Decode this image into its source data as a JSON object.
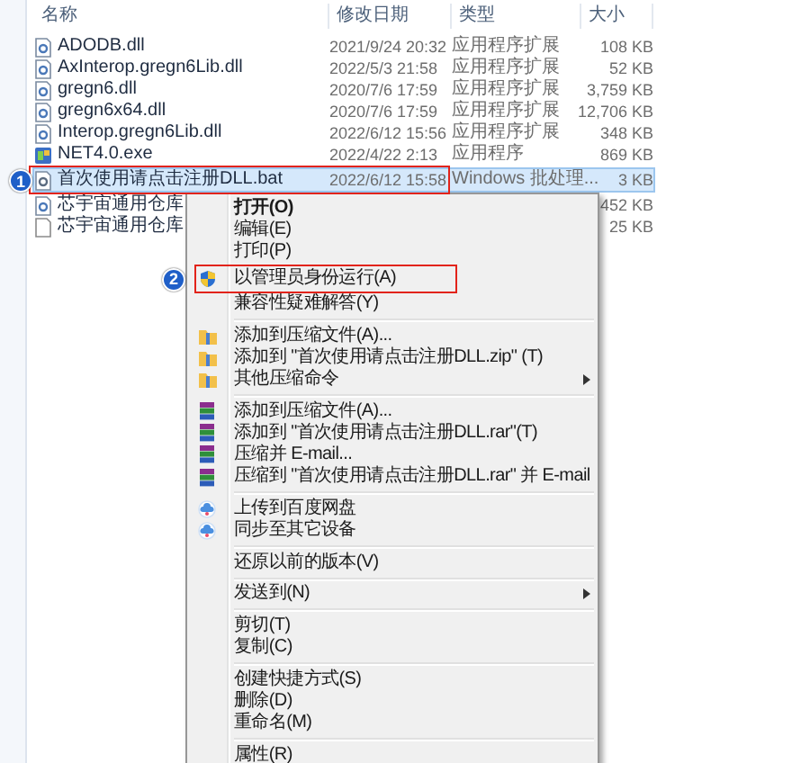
{
  "columns": [
    {
      "label": "名称"
    },
    {
      "label": "修改日期"
    },
    {
      "label": "类型"
    },
    {
      "label": "大小"
    }
  ],
  "files": [
    {
      "kind": "dll",
      "name": "ADODB.dll",
      "date": "2021/9/24 20:32",
      "type": "应用程序扩展",
      "size": "108 KB",
      "selected": false
    },
    {
      "kind": "dll",
      "name": "AxInterop.gregn6Lib.dll",
      "date": "2022/5/3 21:58",
      "type": "应用程序扩展",
      "size": "52 KB",
      "selected": false
    },
    {
      "kind": "dll",
      "name": "gregn6.dll",
      "date": "2020/7/6 17:59",
      "type": "应用程序扩展",
      "size": "3,759 KB",
      "selected": false
    },
    {
      "kind": "dll",
      "name": "gregn6x64.dll",
      "date": "2020/7/6 17:59",
      "type": "应用程序扩展",
      "size": "12,706 KB",
      "selected": false
    },
    {
      "kind": "dll",
      "name": "Interop.gregn6Lib.dll",
      "date": "2022/6/12 15:56",
      "type": "应用程序扩展",
      "size": "348 KB",
      "selected": false
    },
    {
      "kind": "exe",
      "name": "NET4.0.exe",
      "date": "2022/4/22 2:13",
      "type": "应用程序",
      "size": "869 KB",
      "selected": false
    },
    {
      "kind": "bat",
      "name": "首次使用请点击注册DLL.bat",
      "date": "2022/6/12 15:58",
      "type": "Windows 批处理...",
      "size": "3 KB",
      "selected": true,
      "callout": "1"
    },
    {
      "kind": "dll",
      "name": "芯宇宙通用仓库",
      "size": "452 KB",
      "selected": false
    },
    {
      "kind": "doc",
      "name": "芯宇宙通用仓库",
      "size": "25 KB",
      "selected": false
    }
  ],
  "context_menu": {
    "groups": [
      [
        {
          "label": "打开(O)",
          "bold": true
        },
        {
          "label": "编辑(E)"
        },
        {
          "label": "打印(P)"
        },
        {
          "label": "以管理员身份运行(A)",
          "kind": "shield",
          "callout": "2"
        },
        {
          "label": "兼容性疑难解答(Y)"
        }
      ],
      [
        {
          "label": "添加到压缩文件(A)...",
          "kind": "zip"
        },
        {
          "label": "添加到 \"首次使用请点击注册DLL.zip\" (T)",
          "kind": "zip"
        },
        {
          "label": "其他压缩命令",
          "kind": "zip",
          "submenu": true
        }
      ],
      [
        {
          "label": "添加到压缩文件(A)...",
          "kind": "rar"
        },
        {
          "label": "添加到 \"首次使用请点击注册DLL.rar\"(T)",
          "kind": "rar"
        },
        {
          "label": "压缩并 E-mail...",
          "kind": "rar"
        },
        {
          "label": "压缩到 \"首次使用请点击注册DLL.rar\" 并 E-mail",
          "kind": "rar"
        }
      ],
      [
        {
          "label": "上传到百度网盘",
          "kind": "cloud"
        },
        {
          "label": "同步至其它设备",
          "kind": "cloud"
        }
      ],
      [
        {
          "label": "还原以前的版本(V)"
        }
      ],
      [
        {
          "label": "发送到(N)",
          "submenu": true
        }
      ],
      [
        {
          "label": "剪切(T)"
        },
        {
          "label": "复制(C)"
        }
      ],
      [
        {
          "label": "创建快捷方式(S)"
        },
        {
          "label": "删除(D)"
        },
        {
          "label": "重命名(M)"
        }
      ],
      [
        {
          "label": "属性(R)"
        }
      ]
    ]
  }
}
